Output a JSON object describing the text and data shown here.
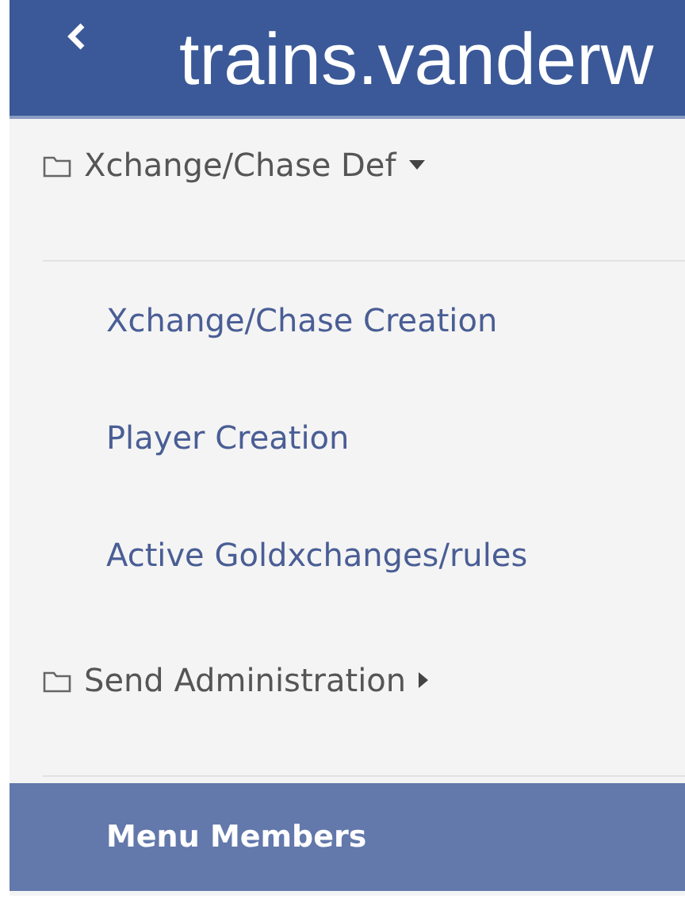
{
  "header": {
    "title": "trains.vanderw"
  },
  "menu": [
    {
      "kind": "group",
      "label": "Xchange/Chase Def",
      "expanded": true,
      "children": [
        {
          "label": "Xchange/Chase Creation",
          "selected": false
        },
        {
          "label": "Player Creation",
          "selected": false
        },
        {
          "label": "Active Goldxchanges/rules",
          "selected": false
        }
      ]
    },
    {
      "kind": "group",
      "label": "Send Administration",
      "expanded": false
    },
    {
      "kind": "link",
      "label": "Menu Members",
      "selected": true
    }
  ]
}
